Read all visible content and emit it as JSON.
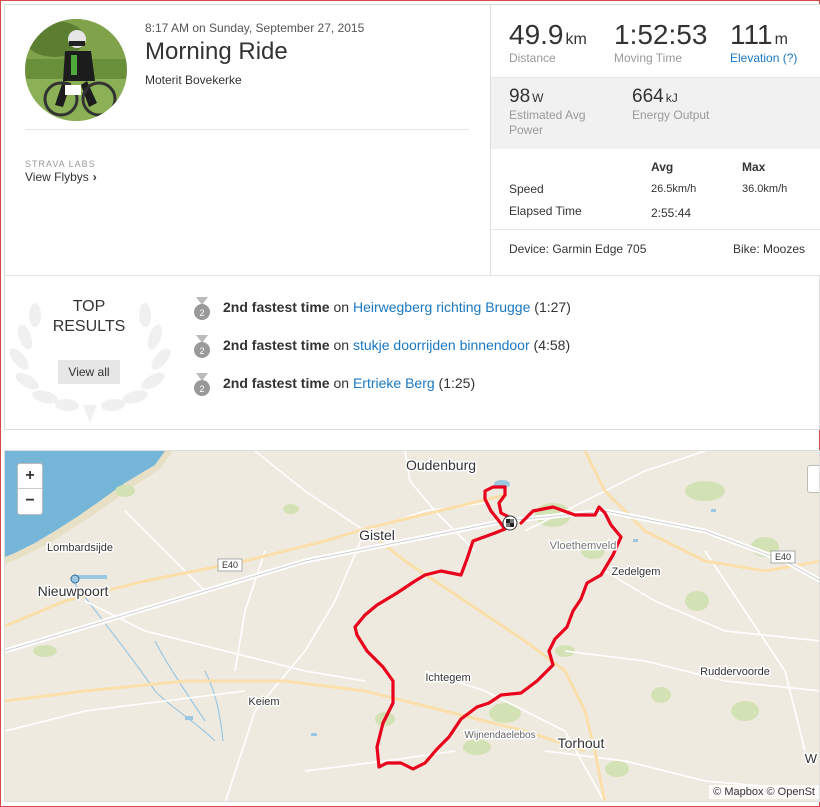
{
  "header": {
    "datetime": "8:17 AM on Sunday, September 27, 2015",
    "title": "Morning Ride",
    "location": "Moterit Bovekerke"
  },
  "labs": {
    "tag": "STRAVA LABS",
    "flybys_label": "View Flybys"
  },
  "stats": {
    "distance": {
      "value": "49.9",
      "unit": "km",
      "label": "Distance"
    },
    "moving_time": {
      "value": "1:52:53",
      "label": "Moving Time"
    },
    "elevation": {
      "value": "111",
      "unit": "m",
      "label": "Elevation (?)"
    },
    "power": {
      "value": "98",
      "unit": "W",
      "label1": "Estimated Avg",
      "label2": "Power"
    },
    "energy": {
      "value": "664",
      "unit": "kJ",
      "label": "Energy Output"
    }
  },
  "details": {
    "col_avg": "Avg",
    "col_max": "Max",
    "speed_label": "Speed",
    "speed_avg": "26.5km/h",
    "speed_max": "36.0km/h",
    "elapsed_label": "Elapsed Time",
    "elapsed_avg": "2:55:44",
    "device": "Device: Garmin Edge 705",
    "bike": "Bike: Moozes"
  },
  "top_results": {
    "heading_line1": "TOP",
    "heading_line2": "RESULTS",
    "view_all": "View all",
    "items": [
      {
        "rank_text": "2nd fastest time",
        "on": "on",
        "segment": "Heirwegberg richting Brugge",
        "time": "(1:27)",
        "medal": "2"
      },
      {
        "rank_text": "2nd fastest time",
        "on": "on",
        "segment": "stukje doorrijden binnendoor",
        "time": "(4:58)",
        "medal": "2"
      },
      {
        "rank_text": "2nd fastest time",
        "on": "on",
        "segment": "Ertrieke Berg",
        "time": "(1:25)",
        "medal": "2"
      }
    ]
  },
  "map": {
    "zoom_in": "+",
    "zoom_out": "−",
    "attribution": "© Mapbox © OpenSt",
    "places": {
      "oudenburg": "Oudenburg",
      "gistel": "Gistel",
      "lombardsijde": "Lombardsijde",
      "nieuwpoort": "Nieuwpoort",
      "vloethemveld": "Vloethemveld",
      "zedelgem": "Zedelgem",
      "ichtegem": "Ichtegem",
      "keiem": "Keiem",
      "ruddervoorde": "Ruddervoorde",
      "wijnendaelebos": "Wijnendaelebos",
      "torhout": "Torhout",
      "e40_left": "E40",
      "e40_right": "E40",
      "w_edge": "W"
    }
  },
  "colors": {
    "accent_link": "#1a78c2",
    "route": "#e8001c",
    "sea": "#75b5d8",
    "land": "#efeae0",
    "forest": "#d3e2b4"
  }
}
